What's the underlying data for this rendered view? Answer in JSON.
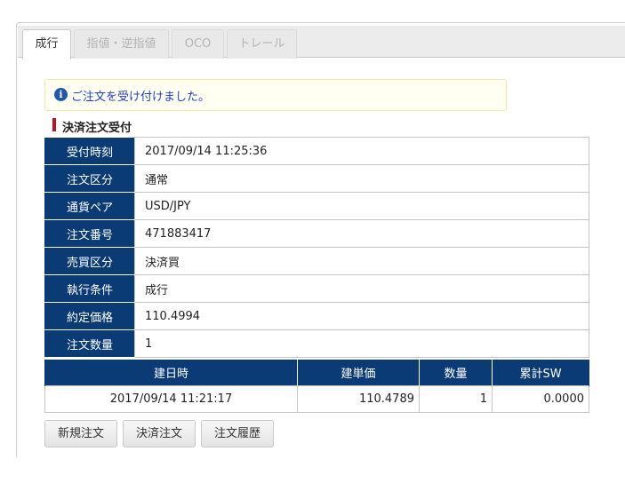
{
  "tabs": [
    {
      "label": "成行",
      "active": true
    },
    {
      "label": "指値・逆指値",
      "active": false
    },
    {
      "label": "OCO",
      "active": false
    },
    {
      "label": "トレール",
      "active": false
    }
  ],
  "notice": {
    "icon": "info-icon",
    "text": "ご注文を受け付けました。"
  },
  "section_title": "決済注文受付",
  "details": [
    {
      "label": "受付時刻",
      "value": "2017/09/14 11:25:36"
    },
    {
      "label": "注文区分",
      "value": "通常"
    },
    {
      "label": "通貨ペア",
      "value": "USD/JPY"
    },
    {
      "label": "注文番号",
      "value": "471883417"
    },
    {
      "label": "売買区分",
      "value": "決済買"
    },
    {
      "label": "執行条件",
      "value": "成行"
    },
    {
      "label": "約定価格",
      "value": "110.4994"
    },
    {
      "label": "注文数量",
      "value": "1"
    }
  ],
  "positions": {
    "headers": [
      "建日時",
      "建単価",
      "数量",
      "累計SW"
    ],
    "rows": [
      [
        "2017/09/14 11:21:17",
        "110.4789",
        "1",
        "0.0000"
      ]
    ]
  },
  "buttons": [
    "新規注文",
    "決済注文",
    "注文履歴"
  ],
  "colors": {
    "header_bg": "#0b3b75",
    "notice_text": "#1f3fc2",
    "notice_bg": "#fffff2",
    "section_mark": "#c1121f"
  }
}
